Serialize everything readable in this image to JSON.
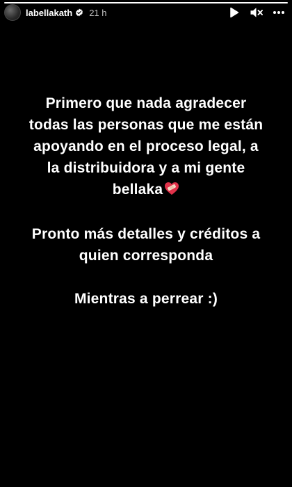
{
  "story": {
    "progress": 1.0
  },
  "header": {
    "username": "labellakath",
    "timestamp": "21 h",
    "avatar_icon": "profile-avatar",
    "verified_icon": "verified-badge-icon",
    "controls": {
      "play_icon": "play-icon",
      "mute_icon": "mute-icon",
      "more_icon": "more-icon"
    }
  },
  "content": {
    "paragraph_1": "Primero que nada agradecer todas las personas que me están apoyando en el proceso legal, a la distribuidora y a mi gente bellaka",
    "paragraph_1_emoji": "heart-with-bandage",
    "paragraph_2": "Pronto más detalles y créditos a quien corresponda",
    "paragraph_3": "Mientras a perrear :)"
  },
  "colors": {
    "background": "#000000",
    "text": "#ffffff",
    "heart": "#e0324a"
  }
}
